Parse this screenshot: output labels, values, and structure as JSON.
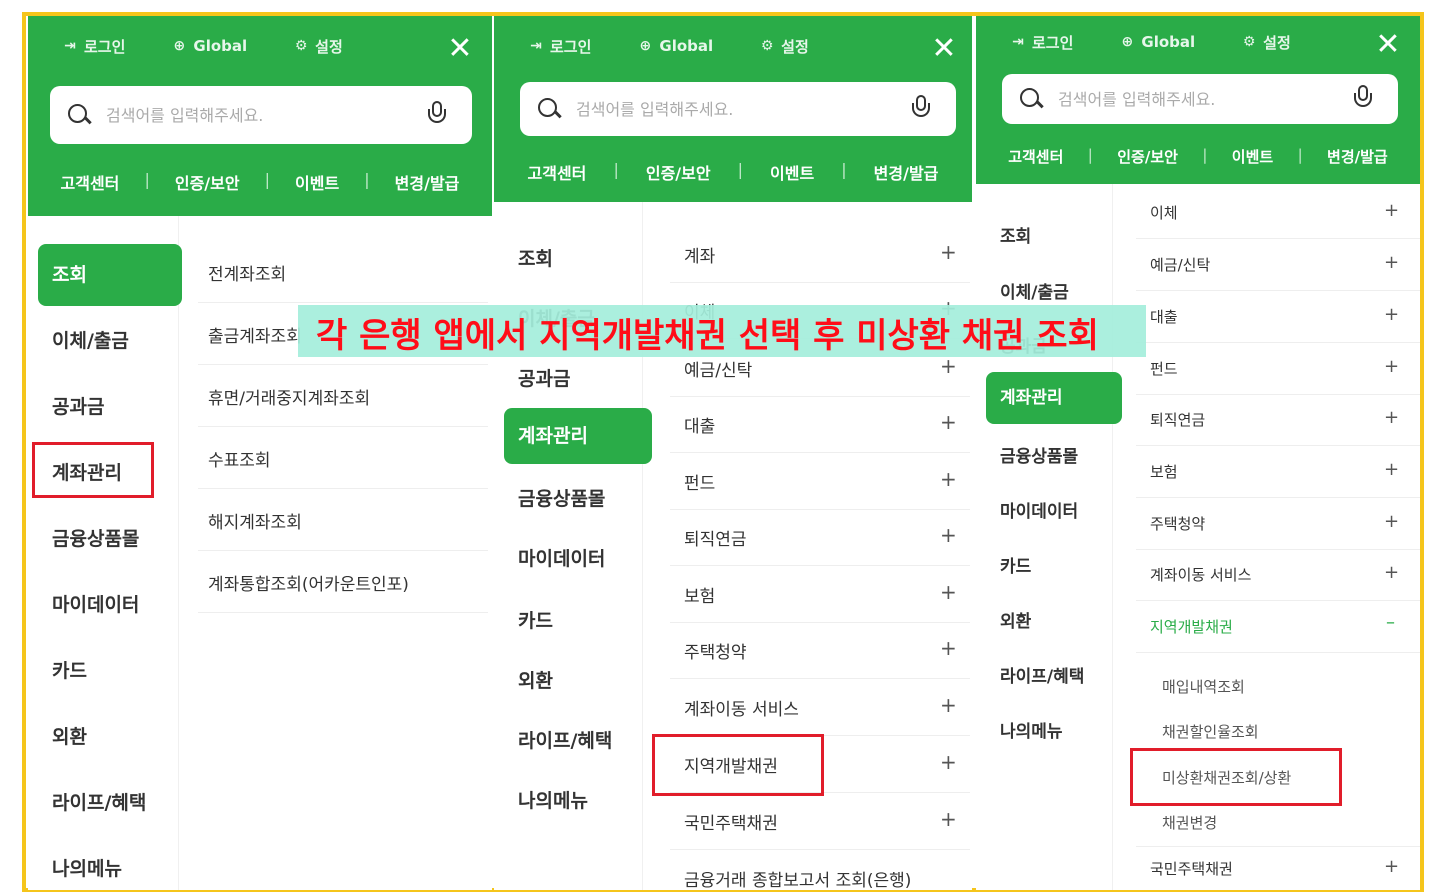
{
  "topbar": {
    "login_label": "로그인",
    "global_label": "Global",
    "settings_label": "설정"
  },
  "search": {
    "placeholder": "검색어를 입력해주세요."
  },
  "quicklinks": [
    "고객센터",
    "인증/보안",
    "이벤트",
    "변경/발급"
  ],
  "left_menu": [
    "조회",
    "이체/출금",
    "공과금",
    "계좌관리",
    "금융상품몰",
    "마이데이터",
    "카드",
    "외환",
    "라이프/혜택",
    "나의메뉴"
  ],
  "panel1": {
    "active": "조회",
    "highlighted": "계좌관리",
    "submenu": [
      "전계좌조회",
      "출금계좌조회",
      "휴면/거래중지계좌조회",
      "수표조회",
      "해지계좌조회",
      "계좌통합조회(어카운트인포)"
    ]
  },
  "panel2": {
    "active": "계좌관리",
    "submenu": [
      "계좌",
      "이체",
      "예금/신탁",
      "대출",
      "펀드",
      "퇴직연금",
      "보험",
      "주택청약",
      "계좌이동 서비스",
      "지역개발채권",
      "국민주택채권",
      "금융거래 종합보고서 조회(은행)"
    ],
    "highlighted": "지역개발채권"
  },
  "panel3": {
    "active": "계좌관리",
    "submenu": [
      "이체",
      "예금/신탁",
      "대출",
      "펀드",
      "퇴직연금",
      "보험",
      "주택청약",
      "계좌이동 서비스",
      "지역개발채권",
      "국민주택채권"
    ],
    "expanded": "지역개발채권",
    "children": [
      "매입내역조회",
      "채권할인율조회",
      "미상환채권조회/상환",
      "채권변경"
    ],
    "highlighted": "미상환채권조회/상환"
  },
  "caption": "각 은행 앱에서 지역개발채권 선택 후 미상환 채권 조회",
  "colors": {
    "brand_green": "#2aac48",
    "highlight_red": "#e11d2a",
    "frame_yellow": "#f5c51b",
    "caption_bg": "#a4eedb",
    "caption_text": "#ff0d18"
  },
  "icons": [
    "login-icon",
    "globe-icon",
    "settings-icon",
    "close-icon",
    "search-icon",
    "mic-icon",
    "plus-icon",
    "minus-icon"
  ]
}
